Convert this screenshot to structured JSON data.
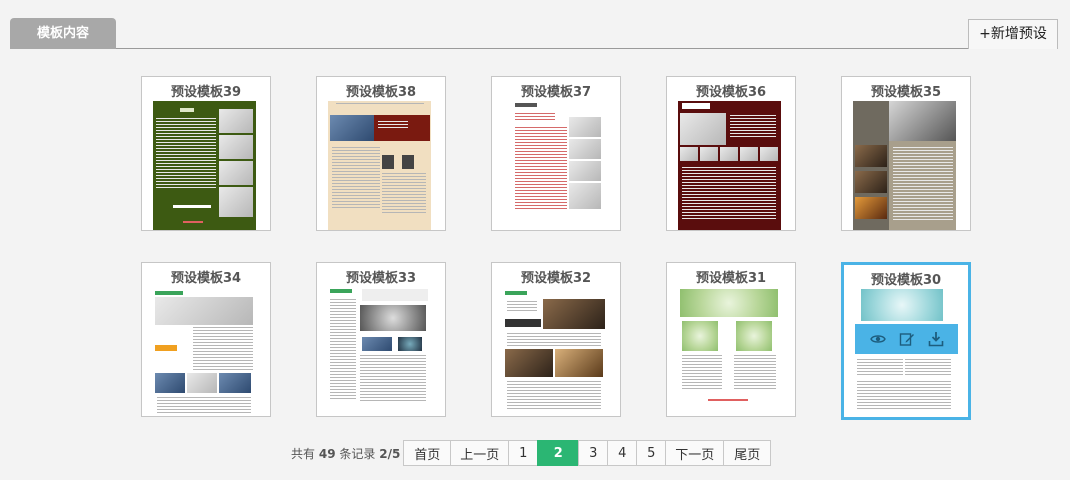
{
  "tabs": {
    "active_label": "模板内容"
  },
  "toolbar": {
    "add_preset_label": "+新增预设"
  },
  "templates": [
    {
      "title": "预设模板39",
      "style": "olive"
    },
    {
      "title": "预设模板38",
      "style": "beige"
    },
    {
      "title": "预设模板37",
      "style": "white-red"
    },
    {
      "title": "预设模板36",
      "style": "darkred"
    },
    {
      "title": "预设模板35",
      "style": "taupe"
    },
    {
      "title": "预设模板34",
      "style": "city"
    },
    {
      "title": "预设模板33",
      "style": "meeting"
    },
    {
      "title": "预设模板32",
      "style": "business"
    },
    {
      "title": "预设模板31",
      "style": "green-fields"
    },
    {
      "title": "预设模板30",
      "style": "teal",
      "selected": true
    }
  ],
  "card_actions": {
    "preview_icon": "eye-icon",
    "edit_icon": "edit-icon",
    "download_icon": "download-icon"
  },
  "pagination": {
    "info_prefix": "共有",
    "total": "49",
    "info_mid": "条记录",
    "page_status": "2/5",
    "first": "首页",
    "prev": "上一页",
    "pages": [
      "1",
      "2",
      "3",
      "4",
      "5"
    ],
    "current": "2",
    "next": "下一页",
    "last": "尾页"
  },
  "colors": {
    "accent_selected": "#4ab3e6",
    "current_page": "#2bb673",
    "tab_bg": "#a8a8a8"
  }
}
